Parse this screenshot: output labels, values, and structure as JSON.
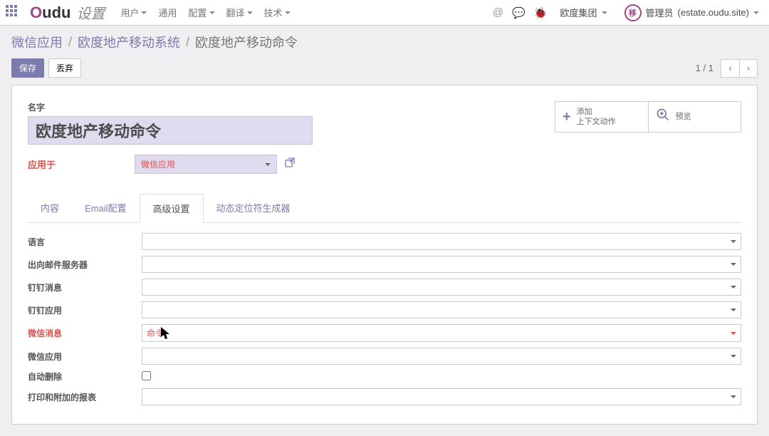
{
  "brand": {
    "prefix_o": "O",
    "rest": "udu"
  },
  "section_title": "设置",
  "nav": [
    {
      "label": "用户",
      "dropdown": true
    },
    {
      "label": "通用",
      "dropdown": false
    },
    {
      "label": "配置",
      "dropdown": true
    },
    {
      "label": "翻译",
      "dropdown": true
    },
    {
      "label": "技术",
      "dropdown": true
    }
  ],
  "top_icons": {
    "at": "@",
    "chat": "💬",
    "bug": "🐞"
  },
  "company": "欧度集团",
  "user": {
    "initial": "移",
    "name": "管理员",
    "site": "(estate.oudu.site)"
  },
  "breadcrumb": {
    "a": "微信应用",
    "b": "欧度地产移动系统",
    "c": "欧度地产移动命令"
  },
  "buttons": {
    "save": "保存",
    "discard": "丢弃"
  },
  "pager": {
    "counter": "1 / 1"
  },
  "form": {
    "name_label": "名字",
    "name_value": "欧度地产移动命令",
    "applied_label": "应用于",
    "applied_value": "微信应用"
  },
  "stat": {
    "add1": "添加",
    "add2": "上下文动作",
    "preview": "预览"
  },
  "tabs": [
    {
      "key": "content",
      "label": "内容"
    },
    {
      "key": "email",
      "label": "Email配置"
    },
    {
      "key": "advanced",
      "label": "高级设置"
    },
    {
      "key": "dynamic",
      "label": "动态定位符生成器"
    }
  ],
  "rows": {
    "lang": "语言",
    "smtp": "出向邮件服务器",
    "ding_msg": "钉钉消息",
    "ding_app": "钉钉应用",
    "wx_msg": "微信消息",
    "wx_msg_value": "命令",
    "wx_app": "微信应用",
    "auto_del": "自动删除",
    "attach": "打印和附加的报表"
  }
}
